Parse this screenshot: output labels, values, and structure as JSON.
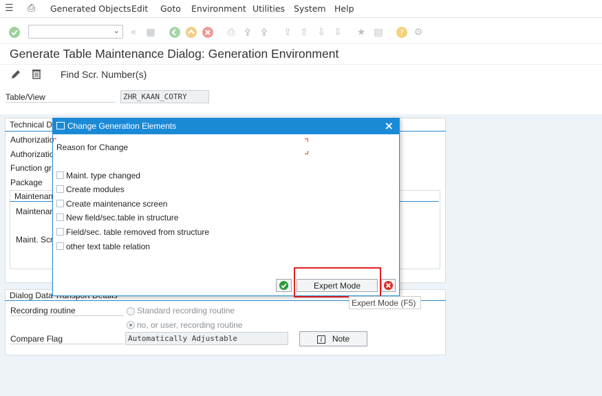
{
  "menubar": {
    "items": [
      "Generated Objects",
      "Edit",
      "Goto",
      "Environment",
      "Utilities",
      "System",
      "Help"
    ]
  },
  "toolbar": {
    "command_value": "",
    "icons": [
      "enter-icon",
      "back-icon",
      "save-icon",
      "exit-icon",
      "cancel-icon",
      "print-icon",
      "find-icon",
      "find-next-icon",
      "first-page-icon",
      "prev-page-icon",
      "next-page-icon",
      "last-page-icon",
      "create-session-icon",
      "shortcut-icon",
      "help-icon",
      "customize-icon"
    ]
  },
  "title": "Generate Table Maintenance Dialog: Generation Environment",
  "app_toolbar": {
    "find_scr": "Find Scr. Number(s)"
  },
  "main": {
    "table_view_label": "Table/View",
    "table_view_value": "ZHR_KAAN_COTRY",
    "tech_details_label": "Technical D",
    "auth_group_label": "Authorizatio",
    "auth_object_label": "Authorizatio",
    "function_group_label": "Function gr",
    "package_label": "Package",
    "maint_type_label": "Maintenan",
    "maint_screens_label": "Maintenan",
    "maint_scr_no_label": "Maint. Scr",
    "transport_title": "Dialog Data Transport Details",
    "recording_routine_label": "Recording routine",
    "radio_standard": "Standard recording routine",
    "radio_no_user": "no, or user, recording routine",
    "compare_flag_label": "Compare Flag",
    "compare_flag_value": "Automatically Adjustable",
    "note_button": "Note",
    "note_icon": "i"
  },
  "dialog": {
    "title": "Change Generation Elements",
    "reason_label": "Reason for Change",
    "checkboxes": [
      "Maint. type changed",
      "Create modules",
      "Create maintenance screen",
      "New field/sec.table in structure",
      "Field/sec. table removed from structure",
      "other text table relation"
    ],
    "expert_mode_button": "Expert Mode",
    "tooltip": "Expert Mode   (F5)"
  },
  "colors": {
    "dialog_title": "#1a8ad7",
    "highlight": "#e01f1f",
    "confirm_green": "#2e9b3a",
    "cancel_red": "#d9302a",
    "main_background": "#eef3f8"
  }
}
